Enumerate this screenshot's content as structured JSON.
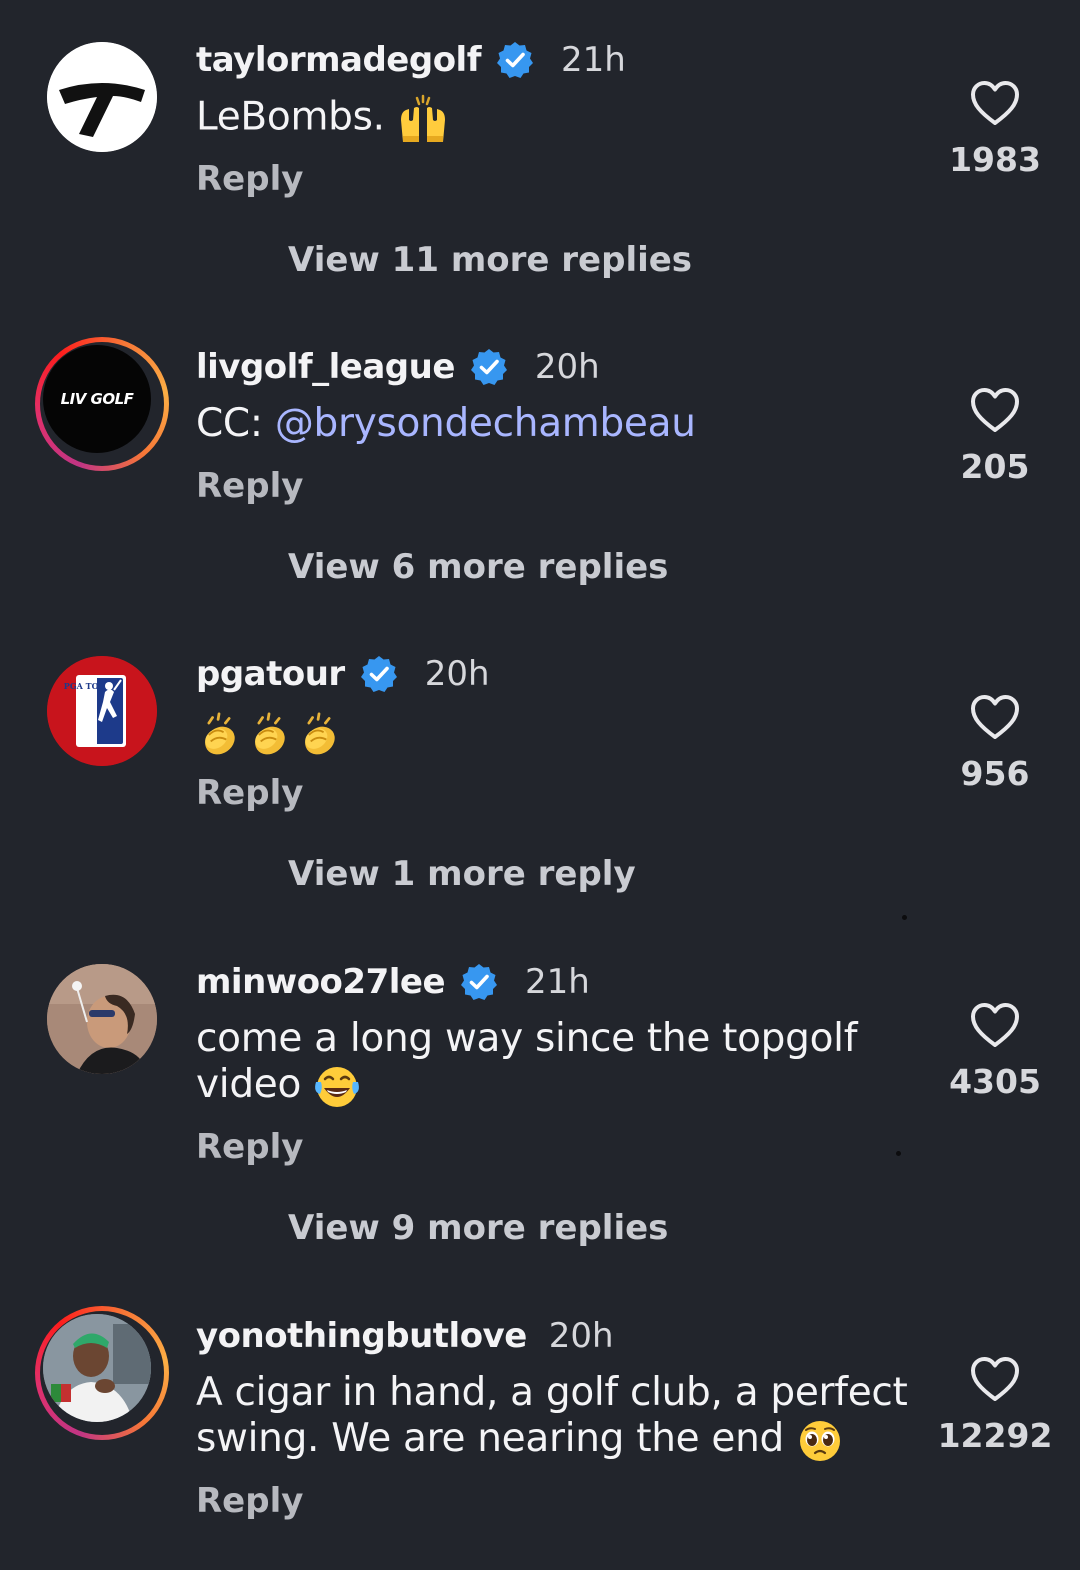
{
  "comments": [
    {
      "username": "taylormadegolf",
      "verified": true,
      "time": "21h",
      "text": "LeBombs.",
      "emoji": "raising-hands",
      "reply": "Reply",
      "likes": "1983",
      "view_more": "View 11 more replies",
      "avatar_ring": false
    },
    {
      "username": "livgolf_league",
      "verified": true,
      "time": "20h",
      "text_prefix": "CC: ",
      "mention": "@brysondechambeau",
      "reply": "Reply",
      "likes": "205",
      "view_more": "View 6 more replies",
      "avatar_logo_text": "LIV GOLF",
      "avatar_ring": true
    },
    {
      "username": "pgatour",
      "verified": true,
      "time": "20h",
      "emoji": "clapping-hands x3",
      "reply": "Reply",
      "likes": "956",
      "view_more": "View 1 more reply",
      "avatar_logo_text": "PGA TOUR",
      "avatar_ring": false
    },
    {
      "username": "minwoo27lee",
      "verified": true,
      "time": "21h",
      "text_line1": "come a long way since the topgolf",
      "text_line2": "video",
      "emoji": "face-with-tears-of-joy",
      "reply": "Reply",
      "likes": "4305",
      "view_more": "View 9 more replies",
      "avatar_ring": false
    },
    {
      "username": "yonothingbutlove",
      "verified": false,
      "time": "20h",
      "text_line1": "A cigar in hand, a golf club, a perfect",
      "text_line2": "swing. We are nearing the end",
      "emoji": "pleading-face",
      "reply": "Reply",
      "likes": "12292",
      "avatar_ring": true
    }
  ],
  "colors": {
    "background": "#22252c",
    "verified": "#3797f0",
    "mention": "#a9b6ff",
    "secondary_text": "#b7b9bf"
  }
}
